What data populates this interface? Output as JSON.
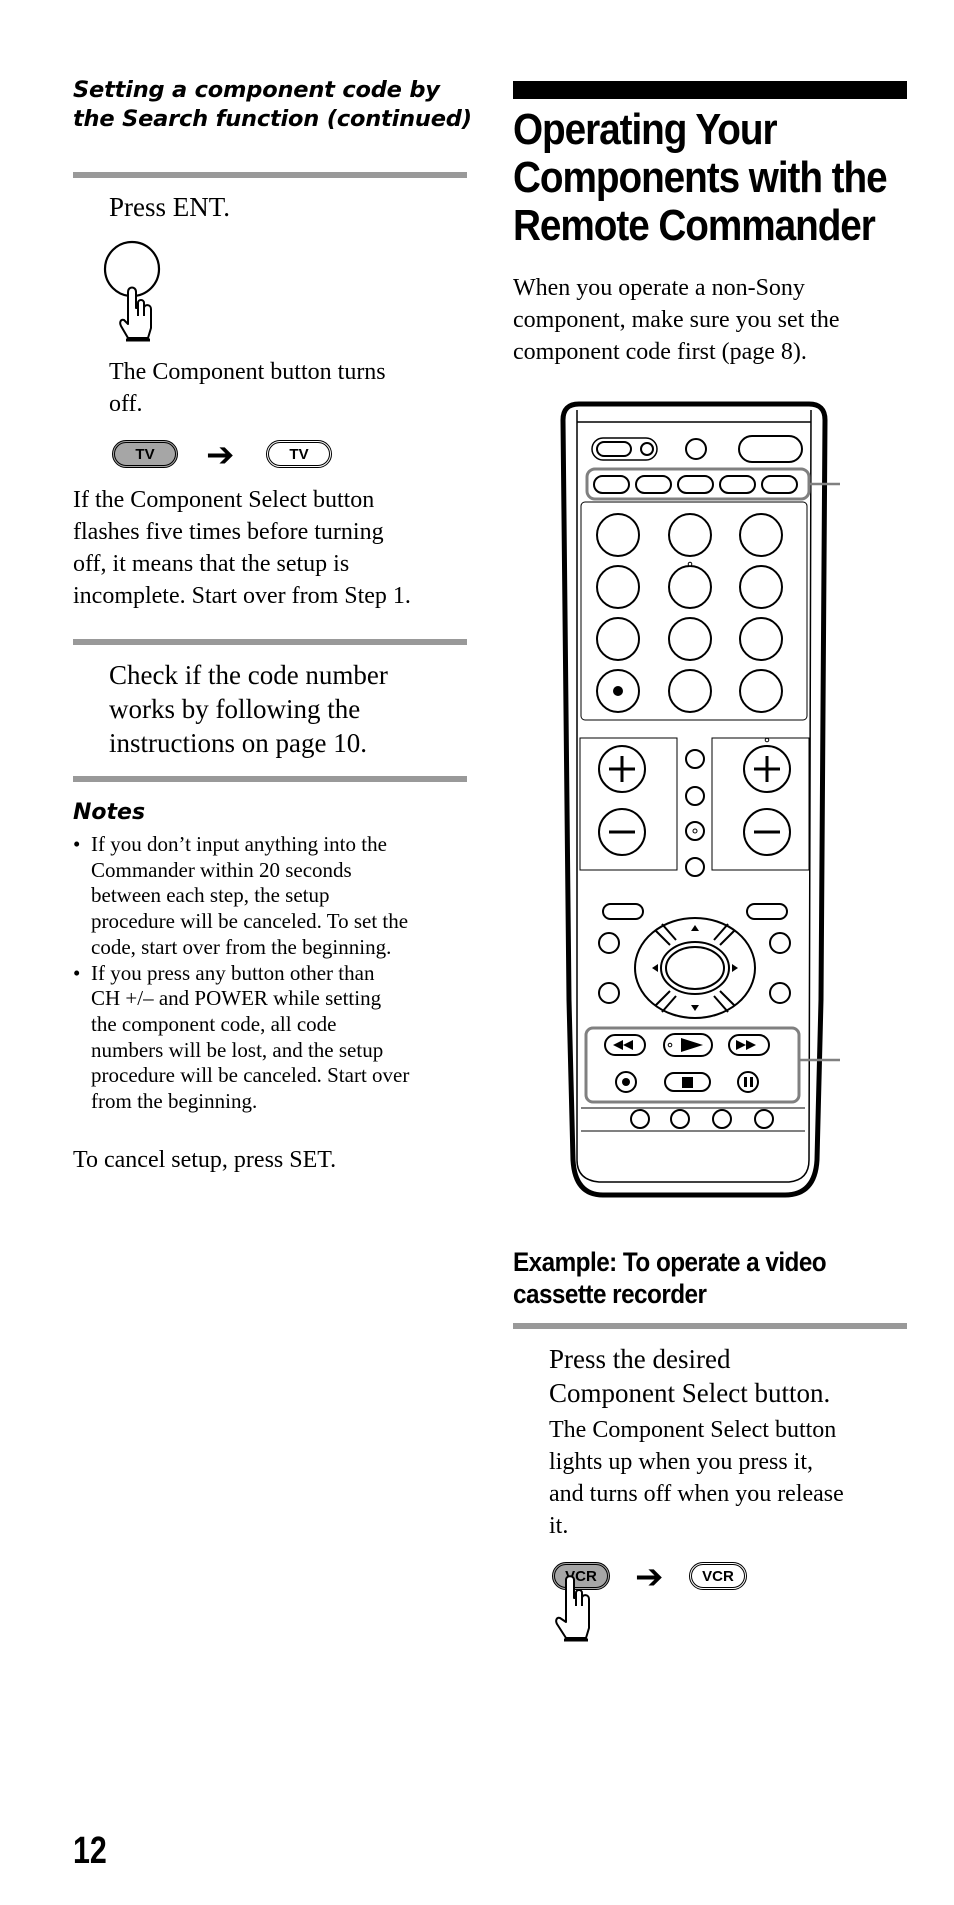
{
  "page": {
    "page_number": "12"
  },
  "left_column": {
    "section_heading_line1": "Setting a component code by",
    "section_heading_line2": "the Search function (continued)",
    "step_press_ent": {
      "instruction": "Press ENT.",
      "result_line1": "The Component button turns",
      "result_line2": "off.",
      "illustration": {
        "from_button_label": "TV",
        "from_state": "lit",
        "arrow": "right-arrow",
        "to_button_label": "TV",
        "to_state": "off"
      },
      "hand_icon": "pointing-hand-icon"
    },
    "incomplete_note": [
      "If the Component Select button",
      "flashes five times before turning",
      "off, it means that the setup is",
      "incomplete. Start over from Step 1."
    ],
    "step_check": [
      "Check if the code number",
      "works by following the",
      "instructions on page 10."
    ],
    "notes": {
      "title": "Notes",
      "items": [
        [
          "If you don’t input anything into the",
          "Commander within 20 seconds",
          "between each step, the setup",
          "procedure will be canceled. To set the",
          "code, start over from the beginning."
        ],
        [
          "If you press any button other than",
          "CH +/– and POWER while setting",
          "the component code, all code",
          "numbers will be lost, and the setup",
          "procedure will be canceled. Start over",
          "from the beginning."
        ]
      ]
    },
    "cancel_text": "To cancel setup, press SET."
  },
  "right_column": {
    "title_line1": "Operating Your",
    "title_line2": "Components with the",
    "title_line3": "Remote Commander",
    "intro": [
      "When you operate a non-Sony",
      "component, make sure you set the",
      "component code first (page 8)."
    ],
    "remote_illustration": {
      "highlighted_groups": [
        "component-select-buttons",
        "vcr-transport-buttons"
      ],
      "number_keys": 12,
      "component_select_buttons": 5,
      "transport_buttons": [
        "rewind",
        "play",
        "fast-forward",
        "record",
        "stop",
        "pause"
      ],
      "bottom_round_buttons": 4
    },
    "example_title_line1": "Example:  To operate a video",
    "example_title_line2": "cassette recorder",
    "step_press_select": {
      "instruction_line1": "Press the desired",
      "instruction_line2": "Component Select button.",
      "result": [
        "The Component Select button",
        "lights up when you press it,",
        "and turns off when you release",
        "it."
      ],
      "illustration": {
        "from_button_label": "VCR",
        "from_state": "lit",
        "arrow": "right-arrow",
        "to_button_label": "VCR",
        "to_state": "off"
      }
    }
  },
  "colors": {
    "rule_gray": "#999999",
    "lit_button": "#a6a6a6",
    "highlight_outline": "#808080",
    "ink": "#000000"
  }
}
